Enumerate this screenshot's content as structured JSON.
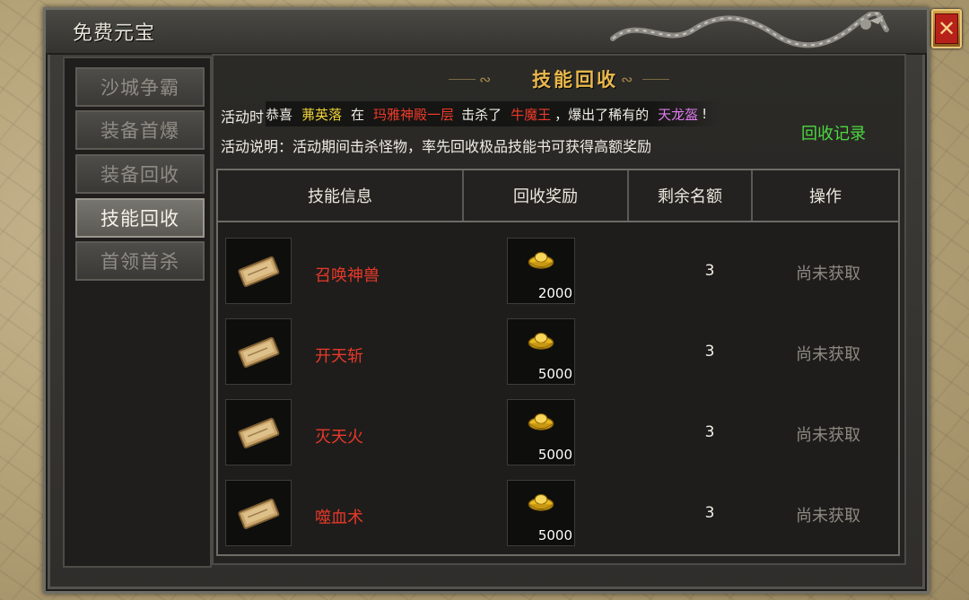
{
  "window": {
    "title": "免费元宝"
  },
  "sidebar": {
    "items": [
      {
        "label": "沙城争霸",
        "active": false
      },
      {
        "label": "装备首爆",
        "active": false
      },
      {
        "label": "装备回收",
        "active": false
      },
      {
        "label": "技能回收",
        "active": true
      },
      {
        "label": "首领首杀",
        "active": false
      }
    ]
  },
  "main": {
    "section_title": "技能回收",
    "activity_time_label": "活动时",
    "banner": {
      "prefix": "恭喜",
      "player": "茀英落",
      "at": "在",
      "location": "玛雅神殿一层",
      "killed": "击杀了",
      "boss": "牛魔王",
      "dropped": "，爆出了稀有的",
      "item": "天龙盔",
      "suffix": "!"
    },
    "description": "活动说明：活动期间击杀怪物，率先回收极品技能书可获得高额奖励",
    "record_link": "回收记录",
    "table": {
      "headers": [
        "技能信息",
        "回收奖励",
        "剩余名额",
        "操作"
      ],
      "rows": [
        {
          "skill": "召唤神兽",
          "reward": "2000",
          "remaining": "3",
          "action": "尚未获取"
        },
        {
          "skill": "开天斩",
          "reward": "5000",
          "remaining": "3",
          "action": "尚未获取"
        },
        {
          "skill": "灭天火",
          "reward": "5000",
          "remaining": "3",
          "action": "尚未获取"
        },
        {
          "skill": "噬血术",
          "reward": "5000",
          "remaining": "3",
          "action": "尚未获取"
        }
      ]
    }
  },
  "icons": {
    "close": "close-icon",
    "skill_book": "skill-book-icon",
    "gold_ingot": "gold-ingot-icon",
    "dragon": "dragon-ornament-icon"
  },
  "colors": {
    "section_title": "#e9b84c",
    "skill_name": "#e8392a",
    "record_link": "#4cd940",
    "player_name": "#f0d23a",
    "location": "#ee3a2a",
    "rare_item": "#e07bf0",
    "status_text": "#8d8a82"
  }
}
